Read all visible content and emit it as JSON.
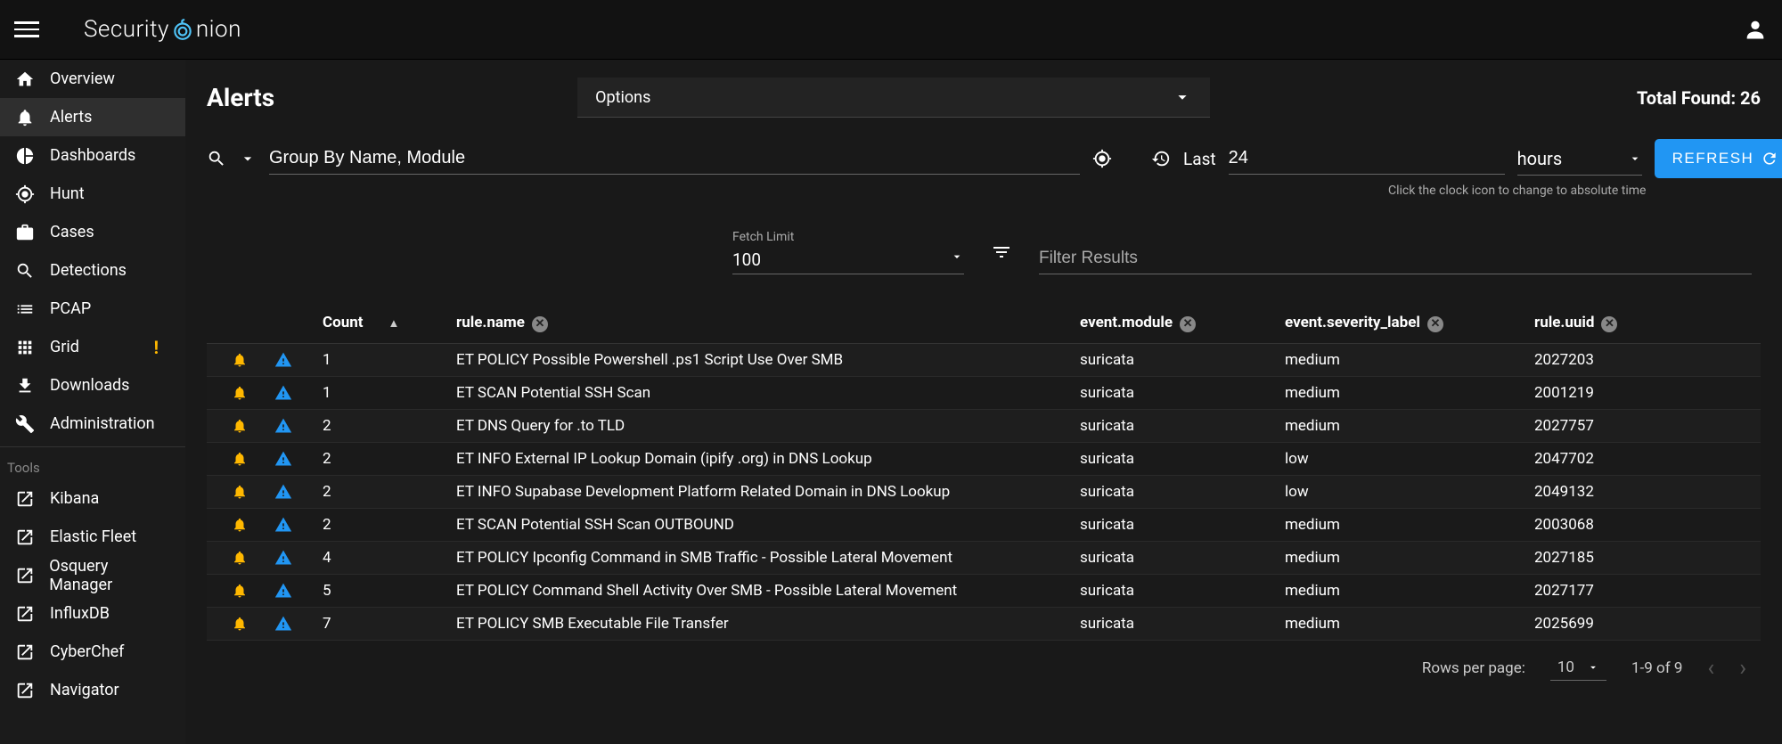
{
  "brand": {
    "part1": "Security",
    "part2": "nion"
  },
  "sidebar": {
    "items": [
      {
        "label": "Overview",
        "icon": "home"
      },
      {
        "label": "Alerts",
        "icon": "bell",
        "active": true
      },
      {
        "label": "Dashboards",
        "icon": "pie"
      },
      {
        "label": "Hunt",
        "icon": "target"
      },
      {
        "label": "Cases",
        "icon": "briefcase"
      },
      {
        "label": "Detections",
        "icon": "search"
      },
      {
        "label": "PCAP",
        "icon": "list"
      },
      {
        "label": "Grid",
        "icon": "grid",
        "warn": true
      },
      {
        "label": "Downloads",
        "icon": "download"
      },
      {
        "label": "Administration",
        "icon": "wrench"
      }
    ],
    "tools_label": "Tools",
    "tools": [
      {
        "label": "Kibana"
      },
      {
        "label": "Elastic Fleet"
      },
      {
        "label": "Osquery Manager"
      },
      {
        "label": "InfluxDB"
      },
      {
        "label": "CyberChef"
      },
      {
        "label": "Navigator"
      }
    ]
  },
  "header": {
    "title": "Alerts",
    "options_label": "Options",
    "total_label": "Total Found: 26"
  },
  "query": {
    "value": "Group By Name, Module",
    "time_prefix": "Last",
    "time_value": "24",
    "time_unit": "hours",
    "refresh_label": "REFRESH",
    "time_hint": "Click the clock icon to change to absolute time"
  },
  "filters": {
    "fetch_label": "Fetch Limit",
    "fetch_value": "100",
    "filter_placeholder": "Filter Results"
  },
  "table": {
    "columns": {
      "count": "Count",
      "rule_name": "rule.name",
      "event_module": "event.module",
      "severity": "event.severity_label",
      "rule_uuid": "rule.uuid"
    },
    "rows": [
      {
        "count": "1",
        "name": "ET POLICY Possible Powershell .ps1 Script Use Over SMB",
        "module": "suricata",
        "severity": "medium",
        "uuid": "2027203"
      },
      {
        "count": "1",
        "name": "ET SCAN Potential SSH Scan",
        "module": "suricata",
        "severity": "medium",
        "uuid": "2001219"
      },
      {
        "count": "2",
        "name": "ET DNS Query for .to TLD",
        "module": "suricata",
        "severity": "medium",
        "uuid": "2027757"
      },
      {
        "count": "2",
        "name": "ET INFO External IP Lookup Domain (ipify .org) in DNS Lookup",
        "module": "suricata",
        "severity": "low",
        "uuid": "2047702"
      },
      {
        "count": "2",
        "name": "ET INFO Supabase Development Platform Related Domain in DNS Lookup",
        "module": "suricata",
        "severity": "low",
        "uuid": "2049132"
      },
      {
        "count": "2",
        "name": "ET SCAN Potential SSH Scan OUTBOUND",
        "module": "suricata",
        "severity": "medium",
        "uuid": "2003068"
      },
      {
        "count": "4",
        "name": "ET POLICY Ipconfig Command in SMB Traffic - Possible Lateral Movement",
        "module": "suricata",
        "severity": "medium",
        "uuid": "2027185"
      },
      {
        "count": "5",
        "name": "ET POLICY Command Shell Activity Over SMB - Possible Lateral Movement",
        "module": "suricata",
        "severity": "medium",
        "uuid": "2027177"
      },
      {
        "count": "7",
        "name": "ET POLICY SMB Executable File Transfer",
        "module": "suricata",
        "severity": "medium",
        "uuid": "2025699"
      }
    ]
  },
  "pager": {
    "rpp_label": "Rows per page:",
    "rpp_value": "10",
    "range": "1-9 of 9"
  }
}
